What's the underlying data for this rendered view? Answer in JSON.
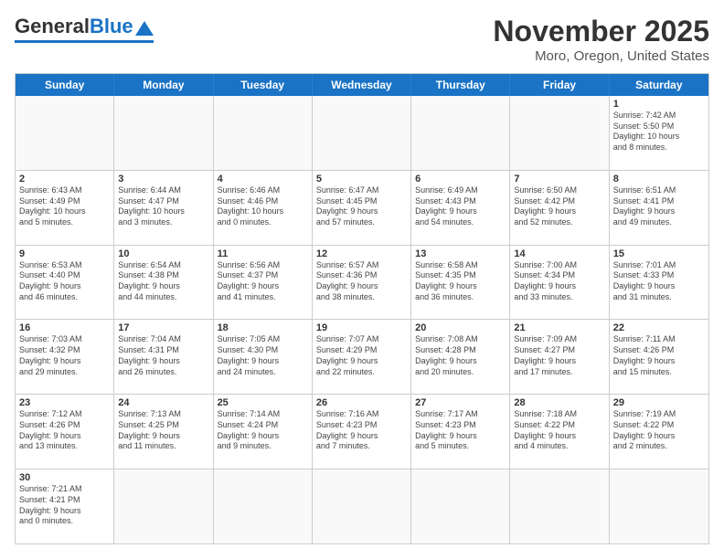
{
  "header": {
    "logo_general": "General",
    "logo_blue": "Blue",
    "title": "November 2025",
    "subtitle": "Moro, Oregon, United States"
  },
  "weekdays": [
    "Sunday",
    "Monday",
    "Tuesday",
    "Wednesday",
    "Thursday",
    "Friday",
    "Saturday"
  ],
  "weeks": [
    [
      {
        "day": "",
        "info": ""
      },
      {
        "day": "",
        "info": ""
      },
      {
        "day": "",
        "info": ""
      },
      {
        "day": "",
        "info": ""
      },
      {
        "day": "",
        "info": ""
      },
      {
        "day": "",
        "info": ""
      },
      {
        "day": "1",
        "info": "Sunrise: 7:42 AM\nSunset: 5:50 PM\nDaylight: 10 hours\nand 8 minutes."
      }
    ],
    [
      {
        "day": "2",
        "info": "Sunrise: 6:43 AM\nSunset: 4:49 PM\nDaylight: 10 hours\nand 5 minutes."
      },
      {
        "day": "3",
        "info": "Sunrise: 6:44 AM\nSunset: 4:47 PM\nDaylight: 10 hours\nand 3 minutes."
      },
      {
        "day": "4",
        "info": "Sunrise: 6:46 AM\nSunset: 4:46 PM\nDaylight: 10 hours\nand 0 minutes."
      },
      {
        "day": "5",
        "info": "Sunrise: 6:47 AM\nSunset: 4:45 PM\nDaylight: 9 hours\nand 57 minutes."
      },
      {
        "day": "6",
        "info": "Sunrise: 6:49 AM\nSunset: 4:43 PM\nDaylight: 9 hours\nand 54 minutes."
      },
      {
        "day": "7",
        "info": "Sunrise: 6:50 AM\nSunset: 4:42 PM\nDaylight: 9 hours\nand 52 minutes."
      },
      {
        "day": "8",
        "info": "Sunrise: 6:51 AM\nSunset: 4:41 PM\nDaylight: 9 hours\nand 49 minutes."
      }
    ],
    [
      {
        "day": "9",
        "info": "Sunrise: 6:53 AM\nSunset: 4:40 PM\nDaylight: 9 hours\nand 46 minutes."
      },
      {
        "day": "10",
        "info": "Sunrise: 6:54 AM\nSunset: 4:38 PM\nDaylight: 9 hours\nand 44 minutes."
      },
      {
        "day": "11",
        "info": "Sunrise: 6:56 AM\nSunset: 4:37 PM\nDaylight: 9 hours\nand 41 minutes."
      },
      {
        "day": "12",
        "info": "Sunrise: 6:57 AM\nSunset: 4:36 PM\nDaylight: 9 hours\nand 38 minutes."
      },
      {
        "day": "13",
        "info": "Sunrise: 6:58 AM\nSunset: 4:35 PM\nDaylight: 9 hours\nand 36 minutes."
      },
      {
        "day": "14",
        "info": "Sunrise: 7:00 AM\nSunset: 4:34 PM\nDaylight: 9 hours\nand 33 minutes."
      },
      {
        "day": "15",
        "info": "Sunrise: 7:01 AM\nSunset: 4:33 PM\nDaylight: 9 hours\nand 31 minutes."
      }
    ],
    [
      {
        "day": "16",
        "info": "Sunrise: 7:03 AM\nSunset: 4:32 PM\nDaylight: 9 hours\nand 29 minutes."
      },
      {
        "day": "17",
        "info": "Sunrise: 7:04 AM\nSunset: 4:31 PM\nDaylight: 9 hours\nand 26 minutes."
      },
      {
        "day": "18",
        "info": "Sunrise: 7:05 AM\nSunset: 4:30 PM\nDaylight: 9 hours\nand 24 minutes."
      },
      {
        "day": "19",
        "info": "Sunrise: 7:07 AM\nSunset: 4:29 PM\nDaylight: 9 hours\nand 22 minutes."
      },
      {
        "day": "20",
        "info": "Sunrise: 7:08 AM\nSunset: 4:28 PM\nDaylight: 9 hours\nand 20 minutes."
      },
      {
        "day": "21",
        "info": "Sunrise: 7:09 AM\nSunset: 4:27 PM\nDaylight: 9 hours\nand 17 minutes."
      },
      {
        "day": "22",
        "info": "Sunrise: 7:11 AM\nSunset: 4:26 PM\nDaylight: 9 hours\nand 15 minutes."
      }
    ],
    [
      {
        "day": "23",
        "info": "Sunrise: 7:12 AM\nSunset: 4:26 PM\nDaylight: 9 hours\nand 13 minutes."
      },
      {
        "day": "24",
        "info": "Sunrise: 7:13 AM\nSunset: 4:25 PM\nDaylight: 9 hours\nand 11 minutes."
      },
      {
        "day": "25",
        "info": "Sunrise: 7:14 AM\nSunset: 4:24 PM\nDaylight: 9 hours\nand 9 minutes."
      },
      {
        "day": "26",
        "info": "Sunrise: 7:16 AM\nSunset: 4:23 PM\nDaylight: 9 hours\nand 7 minutes."
      },
      {
        "day": "27",
        "info": "Sunrise: 7:17 AM\nSunset: 4:23 PM\nDaylight: 9 hours\nand 5 minutes."
      },
      {
        "day": "28",
        "info": "Sunrise: 7:18 AM\nSunset: 4:22 PM\nDaylight: 9 hours\nand 4 minutes."
      },
      {
        "day": "29",
        "info": "Sunrise: 7:19 AM\nSunset: 4:22 PM\nDaylight: 9 hours\nand 2 minutes."
      }
    ],
    [
      {
        "day": "30",
        "info": "Sunrise: 7:21 AM\nSunset: 4:21 PM\nDaylight: 9 hours\nand 0 minutes."
      },
      {
        "day": "",
        "info": ""
      },
      {
        "day": "",
        "info": ""
      },
      {
        "day": "",
        "info": ""
      },
      {
        "day": "",
        "info": ""
      },
      {
        "day": "",
        "info": ""
      },
      {
        "day": "",
        "info": ""
      }
    ]
  ]
}
